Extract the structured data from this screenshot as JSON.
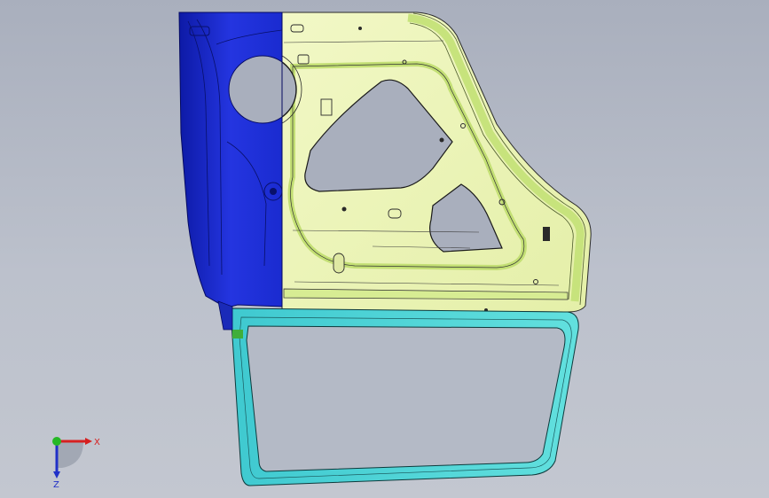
{
  "view": {
    "background_top": "#a9afbd",
    "background_bottom": "#c3c7d0"
  },
  "part": {
    "colors": {
      "face_blue": "#1e2fd8",
      "face_blue_edge": "#0b1590",
      "face_yellow": "#ecf5b8",
      "face_green": "#cfe889",
      "face_cyan": "#4fd6d8",
      "edge_dark": "#1c1c1c",
      "hole": "#a9afbd"
    }
  },
  "triad": {
    "x_label": "X",
    "z_label": "Z",
    "x_color": "#d62020",
    "y_color": "#25b825",
    "z_color": "#2030c8"
  }
}
